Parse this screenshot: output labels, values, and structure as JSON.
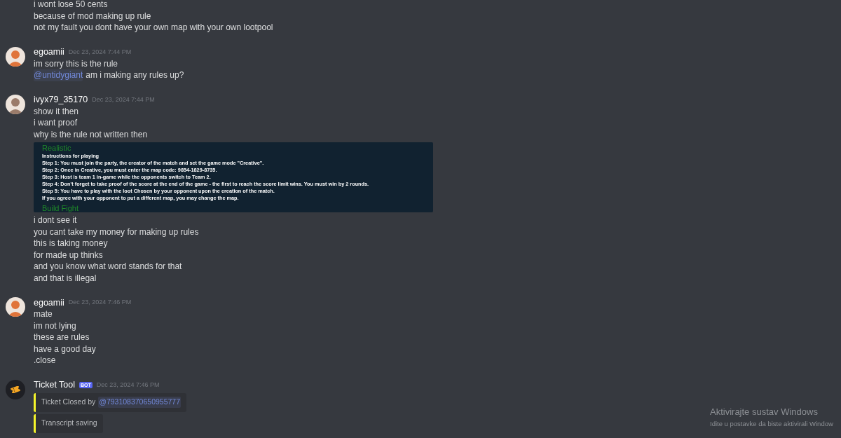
{
  "messages": [
    {
      "kind": "continuation",
      "lines": [
        {
          "kind": "text",
          "text": "i wont lose 50 cents"
        },
        {
          "kind": "text",
          "text": "because of mod making up rule"
        },
        {
          "kind": "text",
          "text": "not my fault you dont have your own map with your own lootpool"
        }
      ]
    },
    {
      "kind": "full",
      "author": "egoamii",
      "avatar": {
        "kind": "user",
        "color": "#e0743a"
      },
      "timestamp": "Dec 23, 2024 7:44 PM",
      "lines": [
        {
          "kind": "text",
          "text": "im sorry this is the rule"
        },
        {
          "kind": "mention",
          "mention": "@untidygiant",
          "text": "am i making any rules up?"
        }
      ]
    },
    {
      "kind": "full",
      "author": "ivyx79_35170",
      "avatar": {
        "kind": "user",
        "color": "#9a7b6a"
      },
      "timestamp": "Dec 23, 2024 7:44 PM",
      "lines": [
        {
          "kind": "text",
          "text": "show it then"
        },
        {
          "kind": "text",
          "text": "i want proof"
        },
        {
          "kind": "text",
          "text": "why is the rule not written then"
        },
        {
          "kind": "image",
          "title": "Realistic",
          "body": [
            "Instructions for playing",
            "Step 1: You must join the party, the creator of the match and set the game mode \"Creative\".",
            "Step 2: Once in Creative, you must enter the map code: 9854-1829-8735.",
            "Step 3: Host is team 1 in-game while the opponents switch to Team 2.",
            "Step 4: Don't forget to take proof of the score at the end of the game - the first to reach the score limit wins. You must win by 2 rounds.",
            "Step 5: You have to play with the loot Chosen by your opponent upon the creation of the match.",
            "If you agree with your opponent to put a different map, you may change the map."
          ],
          "next_title": "Build Fight"
        },
        {
          "kind": "text",
          "text": "i dont see it"
        },
        {
          "kind": "text",
          "text": "you cant take my money for making up rules"
        },
        {
          "kind": "text",
          "text": "this is taking money"
        },
        {
          "kind": "text",
          "text": "for made up thinks"
        },
        {
          "kind": "text",
          "text": "and you know what word stands for that"
        },
        {
          "kind": "text",
          "text": "and that is illegal"
        }
      ]
    },
    {
      "kind": "full",
      "author": "egoamii",
      "avatar": {
        "kind": "user",
        "color": "#e0743a"
      },
      "timestamp": "Dec 23, 2024 7:46 PM",
      "lines": [
        {
          "kind": "text",
          "text": "mate"
        },
        {
          "kind": "text",
          "text": "im not lying"
        },
        {
          "kind": "text",
          "text": "these are rules"
        },
        {
          "kind": "text",
          "text": "have a good day"
        },
        {
          "kind": "text",
          "text": ".close"
        }
      ]
    },
    {
      "kind": "full",
      "author": "Ticket Tool",
      "avatar": {
        "kind": "bot"
      },
      "bot_tag": "BOT",
      "timestamp": "Dec 23, 2024 7:46 PM",
      "lines": [
        {
          "kind": "embed",
          "text": "Ticket Closed by",
          "mention": "@793108370650955777"
        },
        {
          "kind": "embed",
          "text": "Transcript saving"
        }
      ]
    }
  ],
  "activation_notice": {
    "title": "Aktivirajte sustav Windows",
    "subtitle": "Idite u postavke da biste aktivirali Window"
  }
}
